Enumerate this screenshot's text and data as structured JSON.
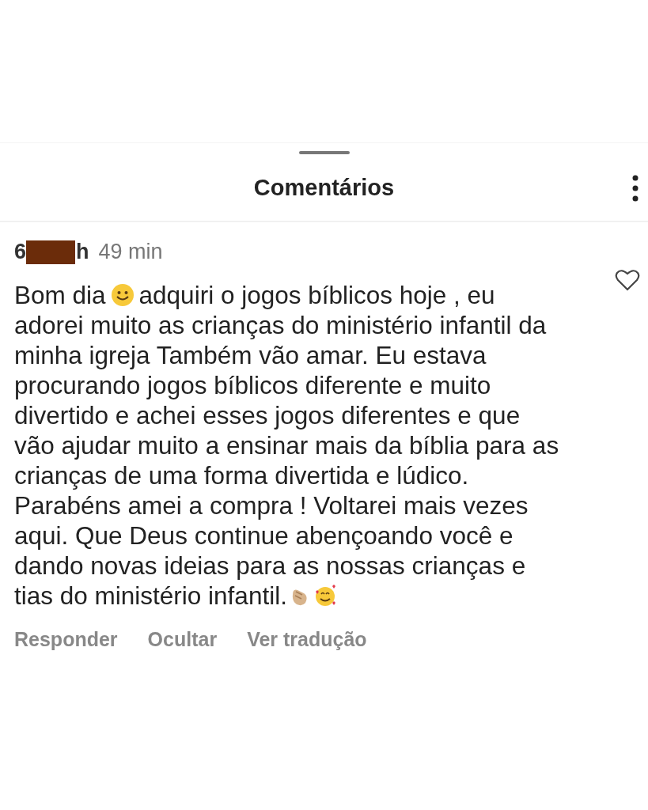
{
  "sheet": {
    "title": "Comentários"
  },
  "comment": {
    "username_start": "6",
    "username_end": "h",
    "time": "49 min",
    "liked": false,
    "body": [
      [
        {
          "kind": "text",
          "text": "Bom dia"
        },
        {
          "kind": "smiley"
        },
        {
          "kind": "text",
          "text": "adquiri o jogos bíblicos hoje , eu"
        }
      ],
      [
        {
          "kind": "text",
          "text": "adorei muito as crianças do ministério infantil da\nminha igreja Também vão amar. Eu estava\nprocurando jogos bíblicos diferente e muito\ndivertido e achei esses jogos diferentes e que\nvão ajudar muito a ensinar mais da bíblia para as\ncrianças de uma forma divertida e lúdico.\nParabéns amei a compra ! Voltarei mais vezes\naqui. Que Deus continue abençoando você e\ndando novas ideias para as nossas crianças e"
        }
      ],
      [
        {
          "kind": "text",
          "text": "tias do ministério infantil."
        },
        {
          "kind": "clap"
        },
        {
          "kind": "hug"
        }
      ]
    ],
    "actions": [
      "Responder",
      "Ocultar",
      "Ver tradução"
    ]
  }
}
